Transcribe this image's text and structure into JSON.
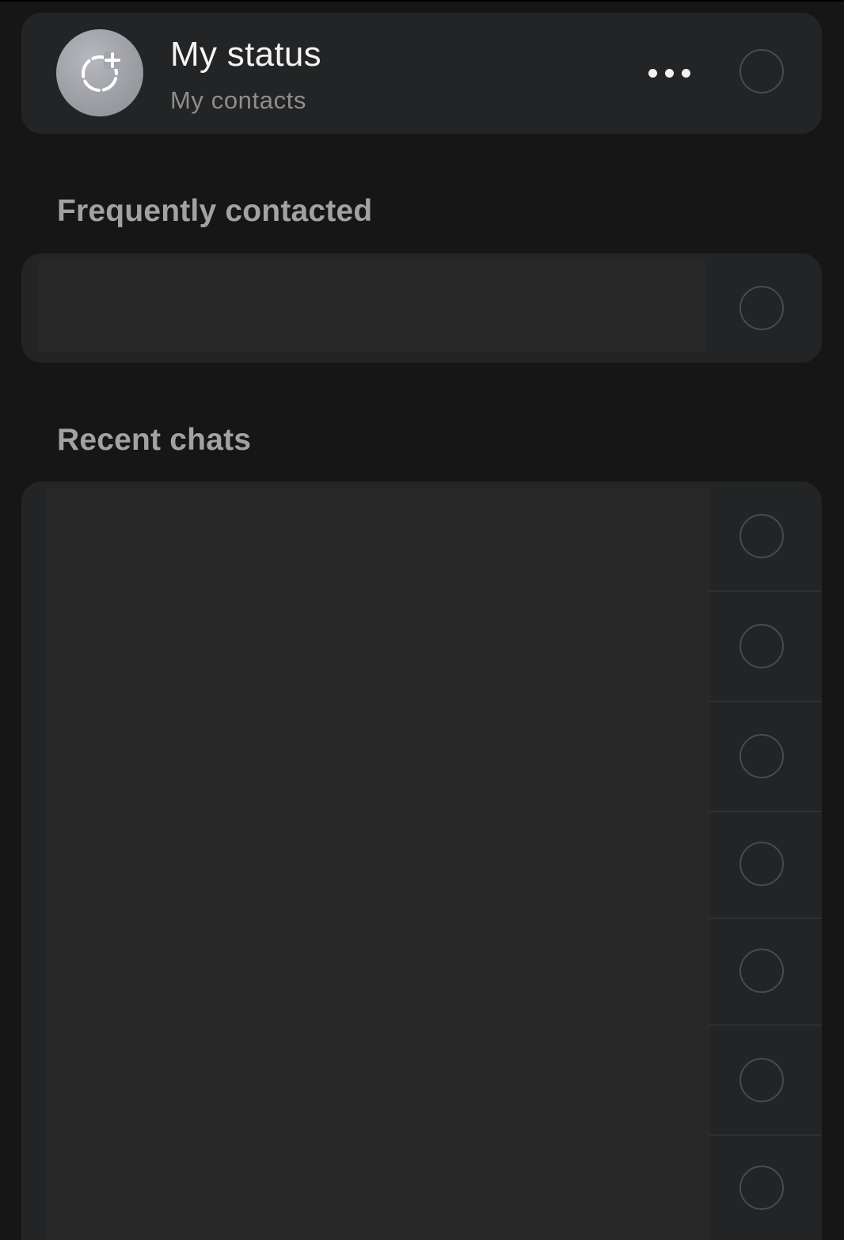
{
  "status": {
    "title": "My status",
    "subtitle": "My contacts",
    "avatar_icon": "status-add-icon",
    "more_icon": "more-horizontal-icon"
  },
  "sections": {
    "frequent_title": "Frequently contacted",
    "recent_title": "Recent chats"
  },
  "frequent_contacts": [
    {
      "selected": false
    }
  ],
  "recent_chats": [
    {
      "selected": false
    },
    {
      "selected": false
    },
    {
      "selected": false
    },
    {
      "selected": false
    },
    {
      "selected": false
    },
    {
      "selected": false
    },
    {
      "selected": false
    }
  ],
  "colors": {
    "background": "#161616",
    "card": "#232425",
    "placeholder": "#282828",
    "selector_border": "#4a4b4d"
  }
}
